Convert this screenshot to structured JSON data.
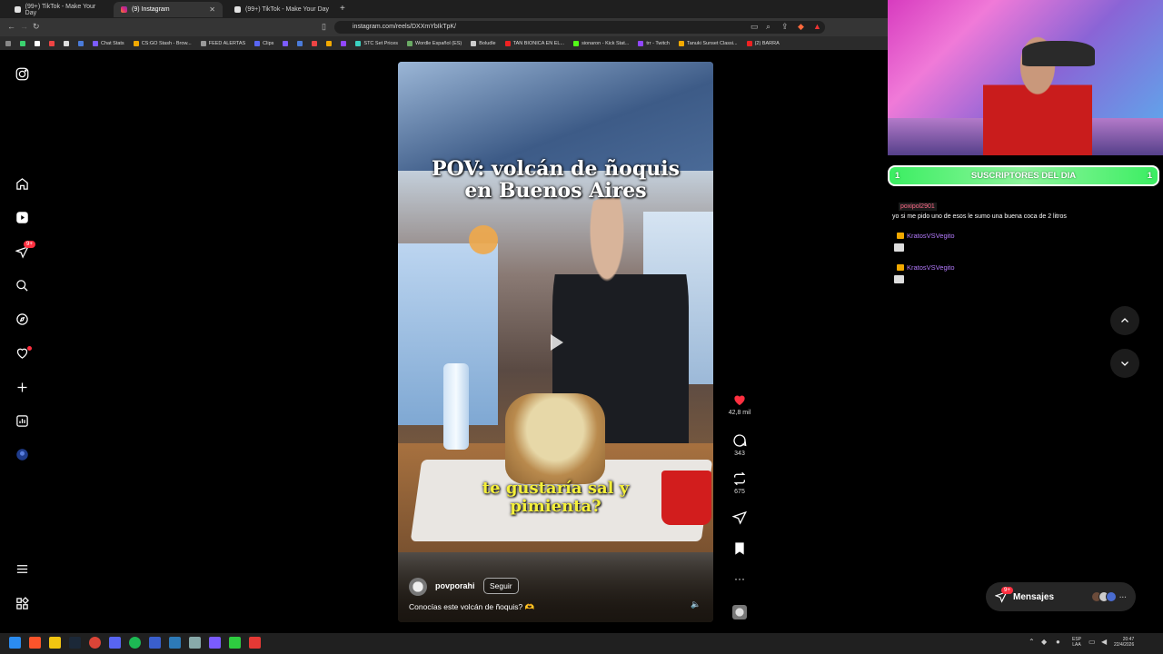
{
  "browser": {
    "tabs": [
      {
        "label": "(99+) TikTok - Make Your Day",
        "active": false
      },
      {
        "label": "(9) Instagram",
        "active": true
      },
      {
        "label": "(99+) TikTok - Make Your Day",
        "active": false
      }
    ],
    "url": "instagram.com/reels/DXXmYbIkTpK/",
    "bookmarks": [
      "Chat Stats",
      "CS:GO Stash - Brow...",
      "FEED ALERTAS",
      "Clips",
      "STC Set Prices",
      "Wordle Español (ES)",
      "Boludle",
      "TAN BIONICA EN EL...",
      "sionaron - Kick Stat...",
      "trr - Twitch",
      "Tanuki Sunset Classi...",
      "(2) BARRA"
    ]
  },
  "sidebar": {
    "notification_badge": "9+",
    "icons": [
      "instagram-icon",
      "home-icon",
      "reels-icon",
      "messages-icon",
      "search-icon",
      "explore-icon",
      "notifications-icon",
      "create-icon",
      "dashboard-icon",
      "profile-icon",
      "menu-icon",
      "more-apps-icon"
    ]
  },
  "reel": {
    "title_line1": "POV: volcán de ñoquis",
    "title_line2": "en Buenos Aires",
    "subtitle_line1": "te gustaría sal y",
    "subtitle_line2": "pimienta?",
    "author": "povporahi",
    "follow_label": "Seguir",
    "caption": "Conocías este volcán de ñoquis? 🫶"
  },
  "actions": {
    "likes": "42,8 mil",
    "comments": "343",
    "reposts": "675"
  },
  "stream": {
    "subs_left": "1",
    "subs_label": "SUSCRIPTORES DEL DIA",
    "subs_right": "1",
    "chat": [
      {
        "user": "poxipol2901",
        "message": "yo si me pido uno de esos le sumo una buena coca de 2 litros"
      },
      {
        "user": "KratosVSVegito",
        "message": ""
      },
      {
        "user": "KratosVSVegito",
        "message": ""
      }
    ]
  },
  "messages_bar": {
    "label": "Mensajes",
    "badge": "9+"
  },
  "taskbar": {
    "lang_line1": "ESP",
    "lang_line2": "LAA",
    "time": "20:47",
    "date": "22/4/2026"
  },
  "colors": {
    "like_red": "#ff3040",
    "subs_green": "#3bee62",
    "subtitle_yellow": "#f4ef3a",
    "chat_user_pink": "#ff6a88",
    "chat_user_purple": "#b57bff"
  }
}
